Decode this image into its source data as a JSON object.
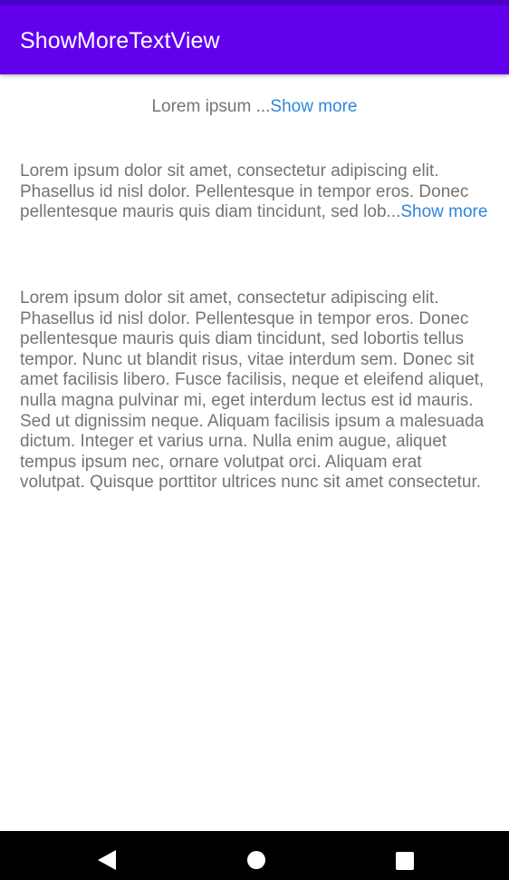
{
  "app_bar": {
    "title": "ShowMoreTextView",
    "color": "#6200ee"
  },
  "blocks": [
    {
      "text": "Lorem ipsum ...",
      "link": "Show more"
    },
    {
      "text": "Lorem ipsum dolor sit amet, consectetur adipiscing elit. Phasellus id nisl dolor. Pellentesque in tempor eros. Donec pellentesque mauris quis diam tincidunt, sed lob...",
      "link": "Show more"
    },
    {
      "text": "Lorem ipsum dolor sit amet, consectetur adipiscing elit. Phasellus id nisl dolor. Pellentesque in tempor eros. Donec pellentesque mauris quis diam tincidunt, sed lobortis tellus tempor. Nunc ut blandit risus, vitae interdum sem. Donec sit amet facilisis libero. Fusce facilisis, neque et eleifend aliquet, nulla magna pulvinar mi, eget interdum lectus est id mauris. Sed ut dignissim neque. Aliquam facilisis ipsum a malesuada dictum. Integer et varius urna. Nulla enim augue, aliquet tempus ipsum nec, ornare volutpat orci. Aliquam erat volutpat. Quisque porttitor ultrices nunc sit amet consectetur."
    }
  ],
  "colors": {
    "body_text": "#747474",
    "link": "#2e86de"
  },
  "nav_bar": {
    "back_icon": "triangle-back-icon",
    "home_icon": "circle-home-icon",
    "recents_icon": "square-recents-icon"
  }
}
